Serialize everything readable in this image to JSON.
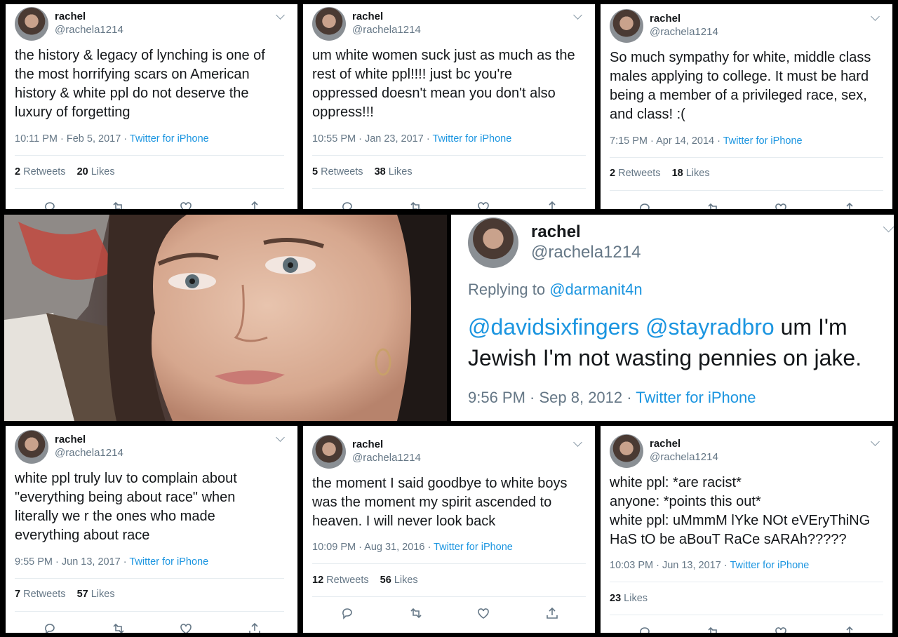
{
  "author": {
    "name": "rachel",
    "handle": "@rachela1214"
  },
  "tweets": [
    {
      "text": "the history & legacy of lynching is one of\nthe most horrifying scars on American\nhistory & white ppl do not deserve the\nluxury of forgetting",
      "time": "10:11 PM · Feb 5, 2017 · ",
      "source": "Twitter for iPhone",
      "retweets": "2",
      "retweets_label": "Retweets",
      "likes": "20",
      "likes_label": "Likes"
    },
    {
      "text": "um white women suck just as much as the\nrest of white ppl!!!! just bc you're\noppressed doesn't mean you don't also\noppress!!!",
      "time": "10:55 PM · Jan 23, 2017 · ",
      "source": "Twitter for iPhone",
      "retweets": "5",
      "retweets_label": "Retweets",
      "likes": "38",
      "likes_label": "Likes"
    },
    {
      "text": "So much sympathy for white, middle class\nmales applying to college. It must be hard\nbeing a member of a privileged race, sex,\nand class! :(",
      "time": "7:15 PM · Apr 14, 2014 · ",
      "source": "Twitter for iPhone",
      "retweets": "2",
      "retweets_label": "Retweets",
      "likes": "18",
      "likes_label": "Likes"
    },
    {
      "text": "white ppl truly luv to complain about\n\"everything being about race\" when\nliterally we r the ones who made\neverything about race",
      "time": "9:55 PM · Jun 13, 2017 · ",
      "source": "Twitter for iPhone",
      "retweets": "7",
      "retweets_label": "Retweets",
      "likes": "57",
      "likes_label": "Likes"
    },
    {
      "text": "the moment I said goodbye to white boys\nwas the moment my spirit ascended to\nheaven. I will never look back",
      "time": "10:09 PM · Aug 31, 2016 · ",
      "source": "Twitter for iPhone",
      "retweets": "12",
      "retweets_label": "Retweets",
      "likes": "56",
      "likes_label": "Likes"
    },
    {
      "text": "white ppl: *are racist*\nanyone: *points this out*\nwhite ppl: uMmmM lYke NOt eVEryThiNG\nHaS tO be aBouT RaCe sARAh?????",
      "time": "10:03 PM · Jun 13, 2017 · ",
      "source": "Twitter for iPhone",
      "likes": "23",
      "likes_label": "Likes"
    }
  ],
  "reply_tweet": {
    "replying_prefix": "Replying to ",
    "replying_to": "@darmanit4n",
    "mention1": "@davidsixfingers",
    "mention2": "@stayradbro",
    "text_rest": " um I'm\nJewish I'm not wasting pennies on jake.",
    "time": "9:56 PM · Sep 8, 2012 · ",
    "source": "Twitter for iPhone"
  },
  "colors": {
    "link": "#1b95e0",
    "secondary": "#657786",
    "background": "#000000"
  },
  "icons": [
    "reply-icon",
    "retweet-icon",
    "like-icon",
    "share-icon",
    "chevron-down-icon"
  ]
}
